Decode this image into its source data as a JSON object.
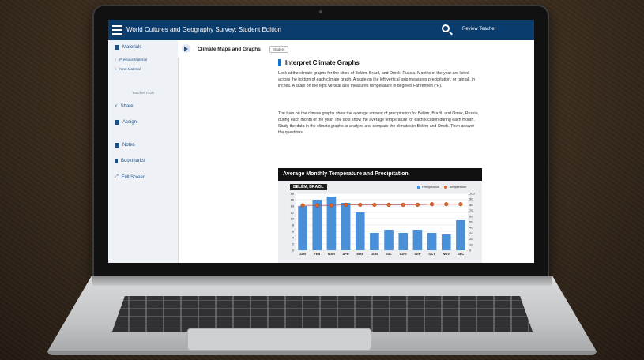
{
  "app": {
    "title": "World Cultures and Geography Survey: Student Edition",
    "user": "Review Teacher"
  },
  "sidebar": {
    "materials": "Materials",
    "previous": "Previous Material",
    "next": "Next Material",
    "teacher_tools": "Teacher Tools",
    "share": "Share",
    "assign": "Assign",
    "notes": "Notes",
    "bookmarks": "Bookmarks",
    "fullscreen": "Full Screen"
  },
  "lesson": {
    "title": "Climate Maps and Graphs",
    "badge": "Student"
  },
  "section": {
    "title": "Interpret Climate Graphs",
    "para1": "Look at the climate graphs for the cities of Belém, Brazil, and Omsk, Russia. Months of the year are listed across the bottom of each climate graph. A scale on the left vertical axis measures precipitation, or rainfall, in inches. A scale on the right vertical axis measures temperature in degrees Fahrenheit (°F).",
    "para2": "The bars on the climate graphs show the average amount of precipitation for Belém, Brazil, and Omsk, Russia, during each month of the year. The dots show the average temperature for each location during each month. Study the data in the climate graphs to analyze and compare the climates in Belém and Omsk. Then answer the questions."
  },
  "chart_data": {
    "type": "bar",
    "title": "Average Monthly Temperature and Precipitation",
    "subtitle": "BELÉM, BRAZIL",
    "categories": [
      "JAN",
      "FEB",
      "MAR",
      "APR",
      "MAY",
      "JUN",
      "JUL",
      "AUG",
      "SEP",
      "OCT",
      "NOV",
      "DEC"
    ],
    "series": [
      {
        "name": "Precipitation",
        "values": [
          14,
          16,
          17,
          15,
          12,
          5.5,
          6.5,
          5.5,
          6.5,
          5.5,
          5,
          9.5
        ]
      },
      {
        "name": "Temperature",
        "values": [
          79,
          79,
          79,
          80,
          80,
          80,
          80,
          80,
          80,
          81,
          81,
          81
        ]
      }
    ],
    "y_left": {
      "min": 0,
      "max": 18,
      "ticks": [
        0,
        2,
        4,
        6,
        8,
        10,
        12,
        14,
        16,
        18
      ]
    },
    "y_right": {
      "min": 0,
      "max": 100,
      "ticks": [
        0,
        10,
        20,
        30,
        40,
        50,
        60,
        70,
        80,
        90,
        100
      ]
    },
    "colors": {
      "bar": "#4a90d9",
      "dot": "#d9652b",
      "line": "#c0504d"
    }
  }
}
